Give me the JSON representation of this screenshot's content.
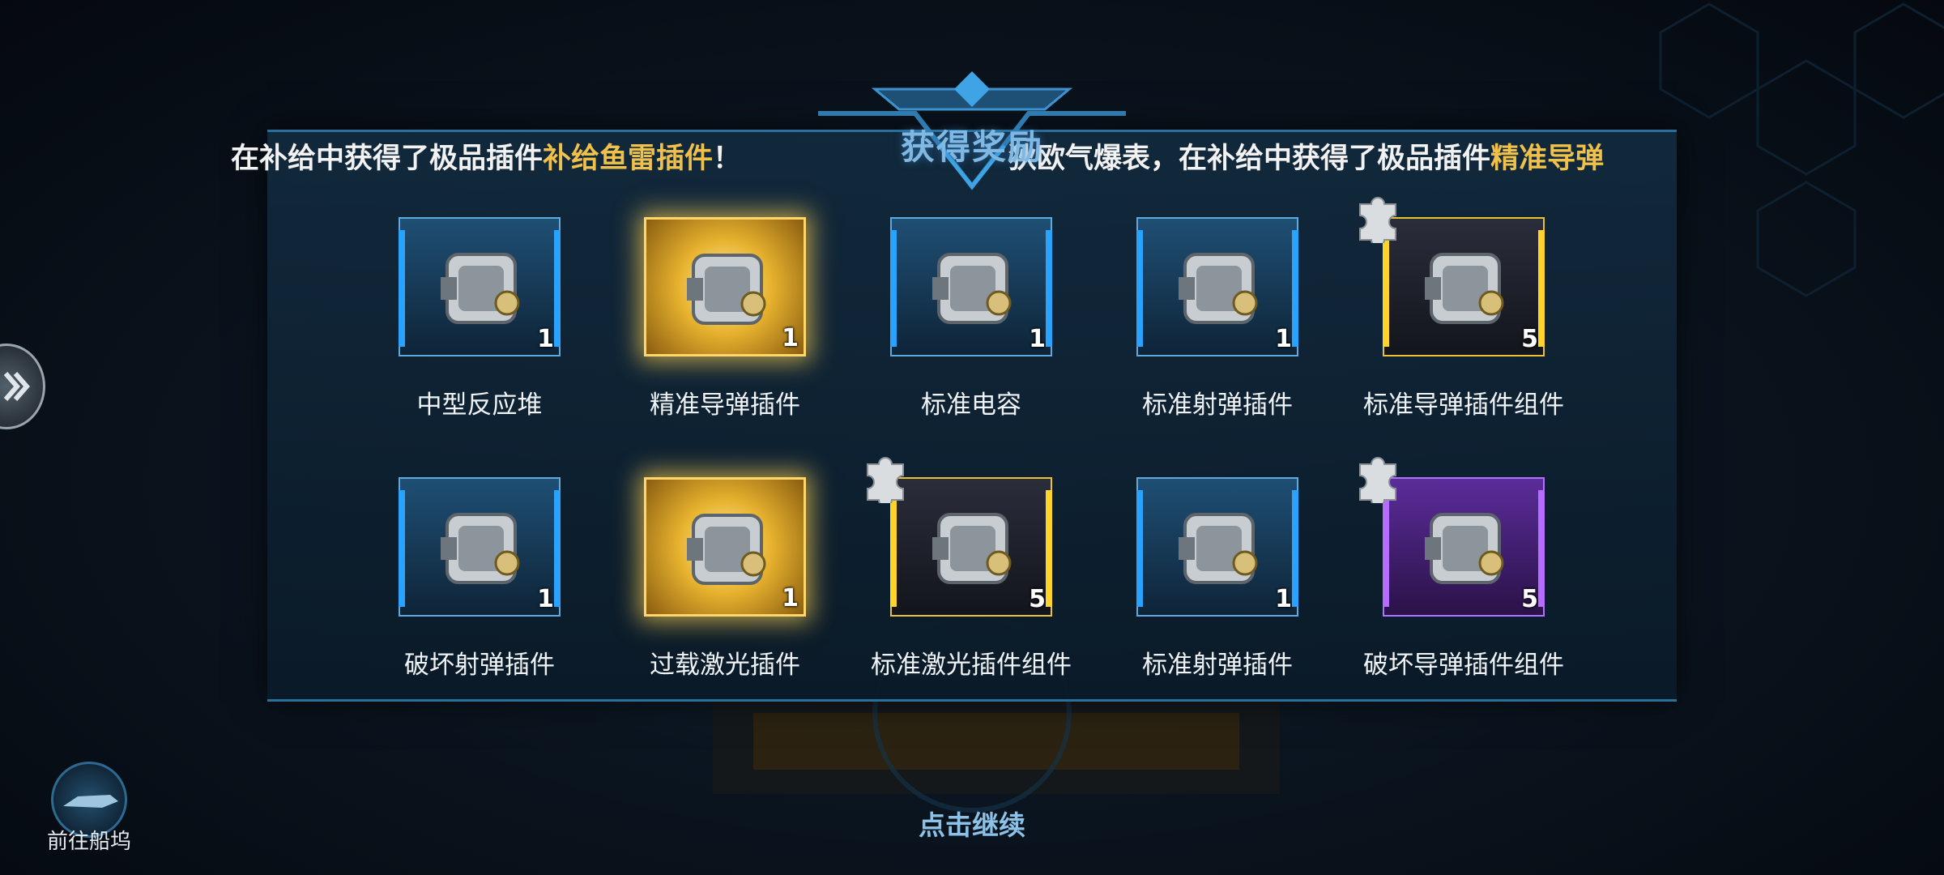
{
  "header": {
    "title": "获得奖励"
  },
  "ticker": {
    "left_prefix": "在补给中获得了极品插件",
    "left_highlight": "补给鱼雷插件",
    "left_suffix": "！",
    "right_prefix": "狄欧气爆表，在补给中获得了极品插件",
    "right_highlight": "精准导弹"
  },
  "rewards": [
    {
      "name": "中型反应堆",
      "qty": "1",
      "rarity": "blue",
      "icon": "reactor-icon",
      "fragment": false
    },
    {
      "name": "精准导弹插件",
      "qty": "1",
      "rarity": "gold",
      "icon": "missile-launcher-icon",
      "fragment": false
    },
    {
      "name": "标准电容",
      "qty": "1",
      "rarity": "blue",
      "icon": "capacitor-icon",
      "fragment": false
    },
    {
      "name": "标准射弹插件",
      "qty": "1",
      "rarity": "blue",
      "icon": "projectile-module-icon",
      "fragment": false
    },
    {
      "name": "标准导弹插件组件",
      "qty": "5",
      "rarity": "yellow",
      "icon": "missile-component-icon",
      "fragment": true
    },
    {
      "name": "破坏射弹插件",
      "qty": "1",
      "rarity": "blue",
      "icon": "cannon-module-icon",
      "fragment": false
    },
    {
      "name": "过载激光插件",
      "qty": "1",
      "rarity": "gold",
      "icon": "laser-module-icon",
      "fragment": false
    },
    {
      "name": "标准激光插件组件",
      "qty": "5",
      "rarity": "yellow",
      "icon": "laser-component-icon",
      "fragment": true
    },
    {
      "name": "标准射弹插件",
      "qty": "1",
      "rarity": "blue",
      "icon": "projectile-module-icon",
      "fragment": false
    },
    {
      "name": "破坏导弹插件组件",
      "qty": "5",
      "rarity": "purple",
      "icon": "missile-drill-component-icon",
      "fragment": true
    }
  ],
  "footer": {
    "continue_label": "点击继续",
    "dock_label": "前往船坞"
  },
  "colors": {
    "highlight": "#f0c14a",
    "title": "#7fb8e2",
    "blue": "#2aa2ff",
    "yellow": "#ffd32a",
    "purple": "#b46dff"
  }
}
